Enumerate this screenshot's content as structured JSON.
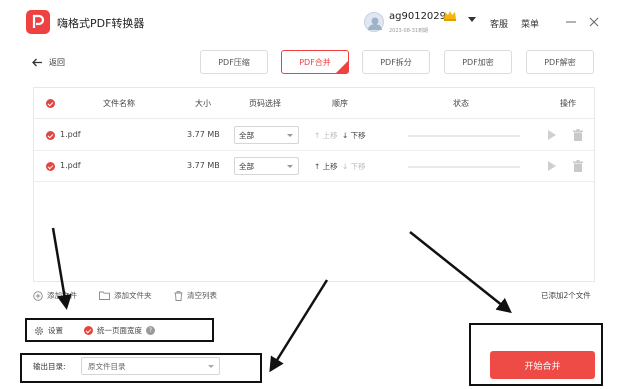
{
  "app": {
    "title": "嗨格式PDF转换器",
    "logo_icon": "pdf-app-logo",
    "brand_color": "#ee4242"
  },
  "user": {
    "name": "ag9012029",
    "date": "2023-08-31到期",
    "vip_icon": "crown-icon"
  },
  "header": {
    "service_label": "客服",
    "menu_label": "菜单"
  },
  "nav": {
    "back_label": "返回",
    "tabs": [
      {
        "label": "PDF压缩",
        "active": false
      },
      {
        "label": "PDF合并",
        "active": true
      },
      {
        "label": "PDF拆分",
        "active": false
      },
      {
        "label": "PDF加密",
        "active": false
      },
      {
        "label": "PDF解密",
        "active": false
      }
    ]
  },
  "table": {
    "headers": {
      "name": "文件名称",
      "size": "大小",
      "pages": "页码选择",
      "order": "顺序",
      "status": "状态",
      "actions": "操作"
    },
    "rows": [
      {
        "name": "1.pdf",
        "size": "3.77 MB",
        "pages": "全部",
        "up": "上移",
        "down": "下移",
        "up_enabled": false,
        "down_enabled": true
      },
      {
        "name": "1.pdf",
        "size": "3.77 MB",
        "pages": "全部",
        "up": "上移",
        "down": "下移",
        "up_enabled": true,
        "down_enabled": false
      }
    ]
  },
  "footer": {
    "add_file": "添加文件",
    "add_folder": "添加文件夹",
    "clear_list": "清空列表",
    "file_count": "已添加2个文件",
    "settings_label": "设置",
    "unify_width_label": "统一页面宽度",
    "help_mark": "?",
    "output_label": "输出目录:",
    "output_value": "原文件目录",
    "start_label": "开始合并"
  }
}
